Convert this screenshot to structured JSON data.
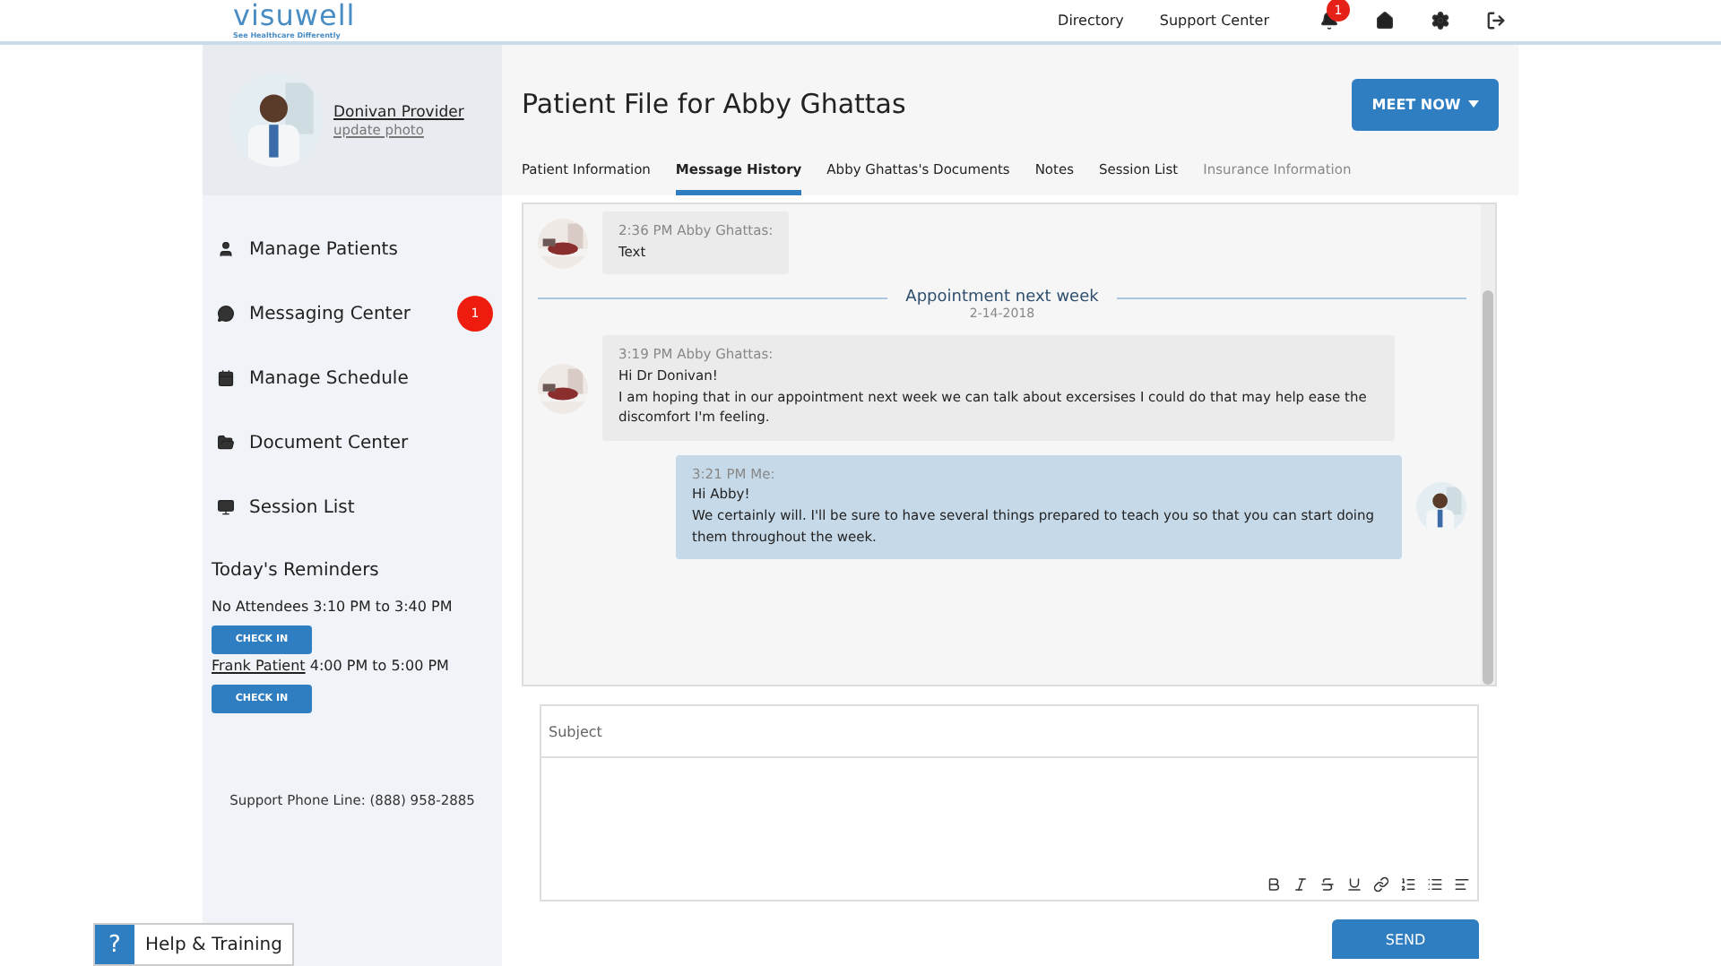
{
  "header": {
    "logo": "visuwell",
    "tagline": "See Healthcare Differently",
    "links": [
      "Directory",
      "Support Center"
    ],
    "notifications": "1"
  },
  "profile": {
    "name": "Donivan Provider",
    "update": "update photo"
  },
  "sidebar": {
    "items": [
      {
        "label": "Manage Patients"
      },
      {
        "label": "Messaging Center",
        "badge": "1"
      },
      {
        "label": "Manage Schedule"
      },
      {
        "label": "Document Center"
      },
      {
        "label": "Session List"
      }
    ],
    "reminders_title": "Today's Reminders",
    "reminders": [
      {
        "name": "No Attendees",
        "linked": false,
        "time": "3:10 PM to 3:40 PM",
        "button": "CHECK IN"
      },
      {
        "name": "Frank Patient",
        "linked": true,
        "time": "4:00 PM to 5:00 PM",
        "button": "CHECK IN"
      }
    ],
    "support": "Support Phone Line: (888) 958-2885"
  },
  "title": "Patient File for Abby Ghattas",
  "meet_button": "MEET NOW",
  "tabs": [
    {
      "label": "Patient Information",
      "selected": false,
      "disabled": false
    },
    {
      "label": "Message History",
      "selected": true,
      "disabled": false
    },
    {
      "label": "Abby Ghattas's Documents",
      "selected": false,
      "disabled": false
    },
    {
      "label": "Notes",
      "selected": false,
      "disabled": false
    },
    {
      "label": "Session List",
      "selected": false,
      "disabled": false
    },
    {
      "label": "Insurance Information",
      "selected": false,
      "disabled": true
    }
  ],
  "messages": [
    {
      "kind": "received",
      "meta": "2:36 PM Abby Ghattas:",
      "lines": [
        "Text"
      ]
    },
    {
      "kind": "divider",
      "title": "Appointment next week",
      "date": "2-14-2018"
    },
    {
      "kind": "received",
      "meta": "3:19 PM Abby Ghattas:",
      "lines": [
        "Hi Dr Donivan!",
        "I am hoping that in our appointment next week we can talk about excersises I could do that may help ease the discomfort I'm feeling."
      ]
    },
    {
      "kind": "sent",
      "meta": "3:21 PM Me:",
      "lines": [
        "Hi Abby!",
        "We certainly will. I'll be sure to have several things prepared to teach you so that you can start doing them throughout the week."
      ]
    }
  ],
  "composer": {
    "placeholder": "Subject",
    "send": "SEND"
  },
  "help": {
    "icon": "?",
    "label": "Help & Training"
  }
}
